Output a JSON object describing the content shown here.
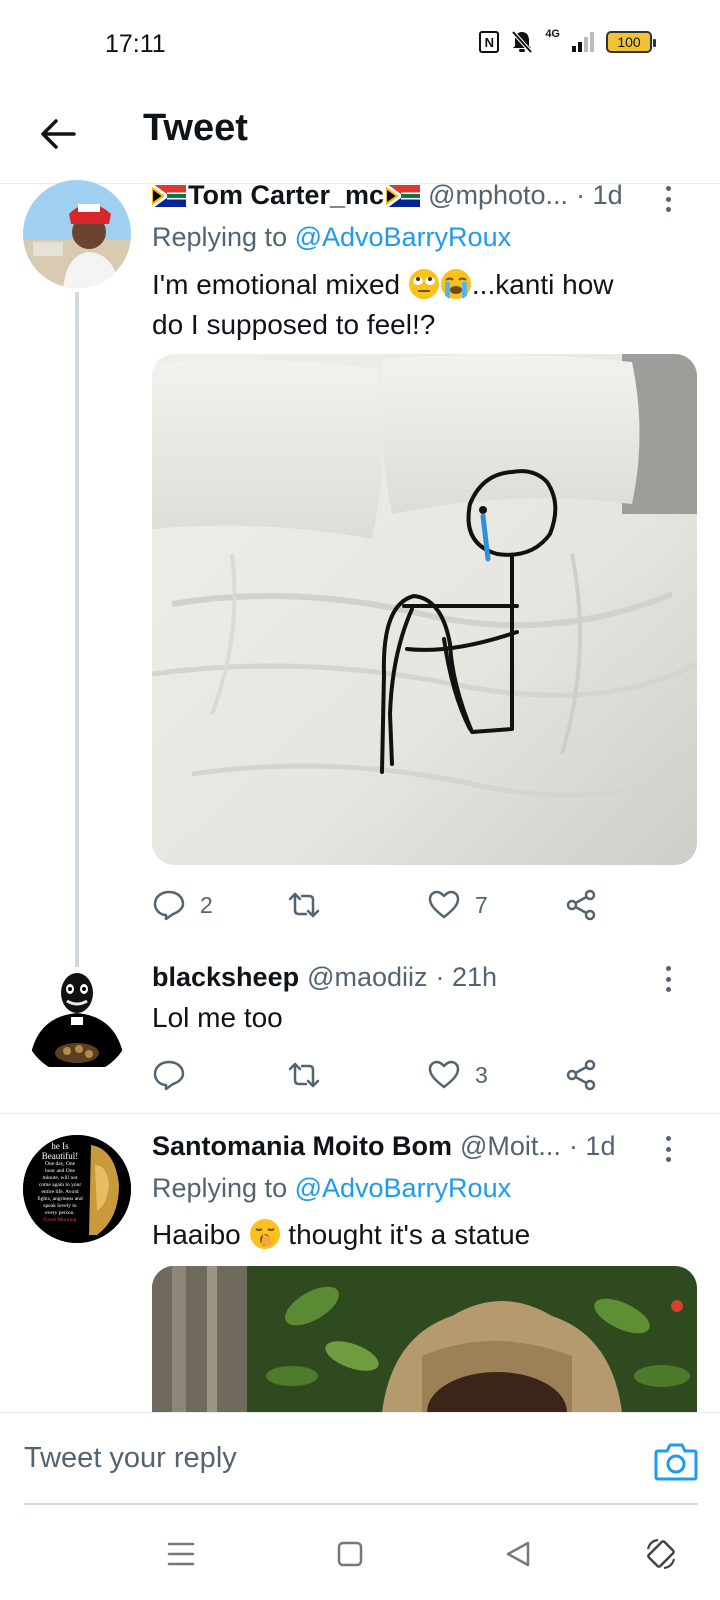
{
  "status_bar": {
    "time": "17:11",
    "network": "4G",
    "battery": "100"
  },
  "header": {
    "title": "Tweet",
    "back_icon": "arrow-left-icon"
  },
  "tweets": [
    {
      "name": "Tom Carter_mc",
      "handle": "@mphoto...",
      "time": "· 1d",
      "replying_prefix": "Replying to ",
      "replying_to": "@AdvoBarryRoux",
      "text_line1": "I'm emotional mixed ",
      "text_line1_end": "...kanti how",
      "text_line2": "do I supposed to feel!?",
      "replies": "2",
      "retweets": "",
      "likes": "7"
    },
    {
      "name": "blacksheep",
      "handle": "@maodiiz",
      "time": "· 21h",
      "text": "Lol me too",
      "replies": "",
      "retweets": "",
      "likes": "3"
    },
    {
      "name": "Santomania Moito Bom",
      "handle": "@Moit...",
      "time": "· 1d",
      "replying_prefix": "Replying to ",
      "replying_to": "@AdvoBarryRoux",
      "text_start": "Haaibo ",
      "text_end": " thought it's a statue",
      "avatar_text": [
        "he Is",
        "Beautiful!",
        "One day, One",
        "hour and One",
        "minute, will not",
        "come again in your",
        "entire life. Avoid",
        "fights, angriness and",
        "speak lovely to",
        "every person.",
        "Good Morning"
      ]
    }
  ],
  "reply_bar": {
    "placeholder": "Tweet your reply"
  },
  "colors": {
    "accent": "#1d9bf0",
    "secondary_text": "#536471",
    "primary_text": "#0f1419"
  }
}
